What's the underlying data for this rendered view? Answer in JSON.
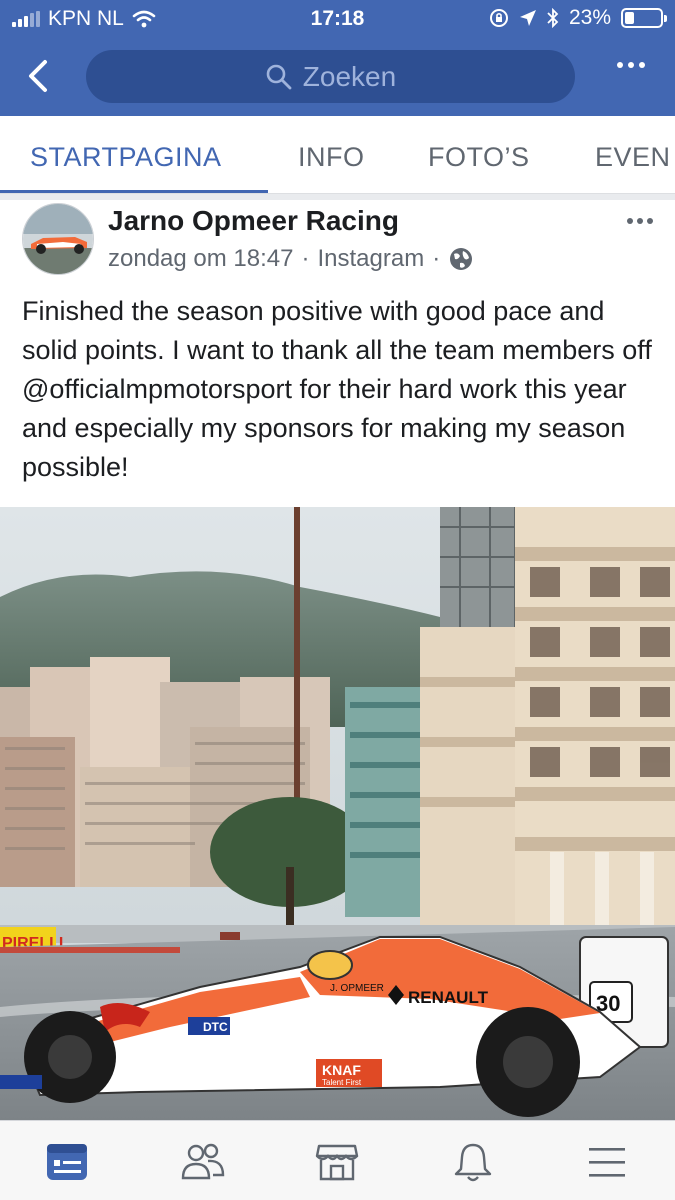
{
  "status_bar": {
    "carrier": "KPN NL",
    "time": "17:18",
    "battery": "23%",
    "battery_level": 0.23
  },
  "header": {
    "search_placeholder": "Zoeken",
    "icons": [
      "back-icon",
      "search-icon",
      "more-icon"
    ]
  },
  "tabs": [
    {
      "label": "STARTPAGINA",
      "active": true
    },
    {
      "label": "INFO",
      "active": false
    },
    {
      "label": "FOTO’S",
      "active": false
    },
    {
      "label": "EVEN",
      "active": false
    }
  ],
  "post": {
    "author": "Jarno Opmeer Racing",
    "time": "zondag om 18:47",
    "separator": "·",
    "source": "Instagram",
    "text": "Finished the season positive with good pace and solid points. I want to thank all the team members off @officialmpmotorsport for their hard work this year and especially my sponsors for making my season possible!",
    "photo": {
      "car_number": "30",
      "sponsor_main": "RENAULT",
      "sponsor_side": "KNAF",
      "sponsor_side_sub": "Talent First",
      "sponsor_dtc": "DTC",
      "driver_name": "J. OPMEER",
      "wall_logo": "PIRELLI",
      "livery_primary": "#f26b3a",
      "livery_secondary": "#ffffff"
    }
  },
  "bottom_nav": [
    {
      "name": "news-feed",
      "icon": "news-feed-icon",
      "active": true
    },
    {
      "name": "friends",
      "icon": "friends-icon",
      "active": false
    },
    {
      "name": "marketplace",
      "icon": "marketplace-icon",
      "active": false
    },
    {
      "name": "notifications",
      "icon": "bell-icon",
      "active": false
    },
    {
      "name": "menu",
      "icon": "menu-icon",
      "active": false
    }
  ],
  "colors": {
    "brand": "#4267b2",
    "search_bg": "#2e4f92",
    "muted_text": "#606770"
  }
}
